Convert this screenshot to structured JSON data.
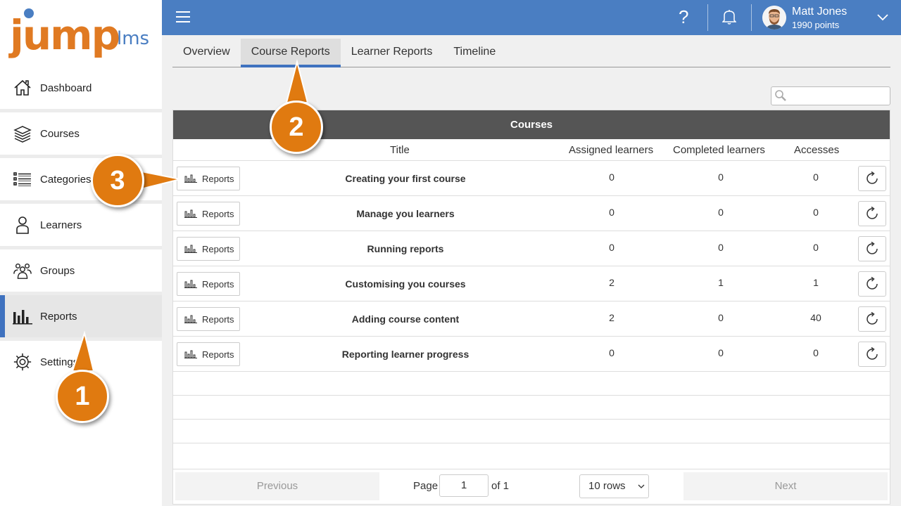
{
  "logo": {
    "main": "jump",
    "suffix": "lms"
  },
  "sidebar": {
    "items": [
      {
        "label": "Dashboard",
        "icon": "home-icon"
      },
      {
        "label": "Courses",
        "icon": "layers-icon"
      },
      {
        "label": "Categories",
        "icon": "list-icon"
      },
      {
        "label": "Learners",
        "icon": "user-icon"
      },
      {
        "label": "Groups",
        "icon": "users-icon"
      },
      {
        "label": "Reports",
        "icon": "bar-chart-icon",
        "active": true
      },
      {
        "label": "Settings",
        "icon": "gear-icon"
      }
    ]
  },
  "topbar": {
    "help": "?",
    "user_name": "Matt Jones",
    "user_points": "1990 points"
  },
  "tabs": [
    {
      "label": "Overview"
    },
    {
      "label": "Course Reports",
      "active": true
    },
    {
      "label": "Learner Reports"
    },
    {
      "label": "Timeline"
    }
  ],
  "search": {
    "placeholder": ""
  },
  "table": {
    "header": "Courses",
    "columns": [
      "Title",
      "Assigned learners",
      "Completed learners",
      "Accesses"
    ],
    "button_label": "Reports",
    "rows": [
      {
        "title": "Creating your first course",
        "assigned": "0",
        "completed": "0",
        "accesses": "0"
      },
      {
        "title": "Manage you learners",
        "assigned": "0",
        "completed": "0",
        "accesses": "0"
      },
      {
        "title": "Running reports",
        "assigned": "0",
        "completed": "0",
        "accesses": "0"
      },
      {
        "title": "Customising you courses",
        "assigned": "2",
        "completed": "1",
        "accesses": "1"
      },
      {
        "title": "Adding course content",
        "assigned": "2",
        "completed": "0",
        "accesses": "40"
      },
      {
        "title": "Reporting learner progress",
        "assigned": "0",
        "completed": "0",
        "accesses": "0"
      }
    ]
  },
  "pager": {
    "previous": "Previous",
    "page_label": "Page",
    "page_value": "1",
    "of_label": "of 1",
    "rows_select": "10 rows",
    "next": "Next"
  },
  "callouts": [
    "1",
    "2",
    "3"
  ],
  "colors": {
    "accent": "#4a7ec2",
    "brand_orange": "#e07a22",
    "callout": "#e07a10",
    "table_header": "#555555"
  }
}
